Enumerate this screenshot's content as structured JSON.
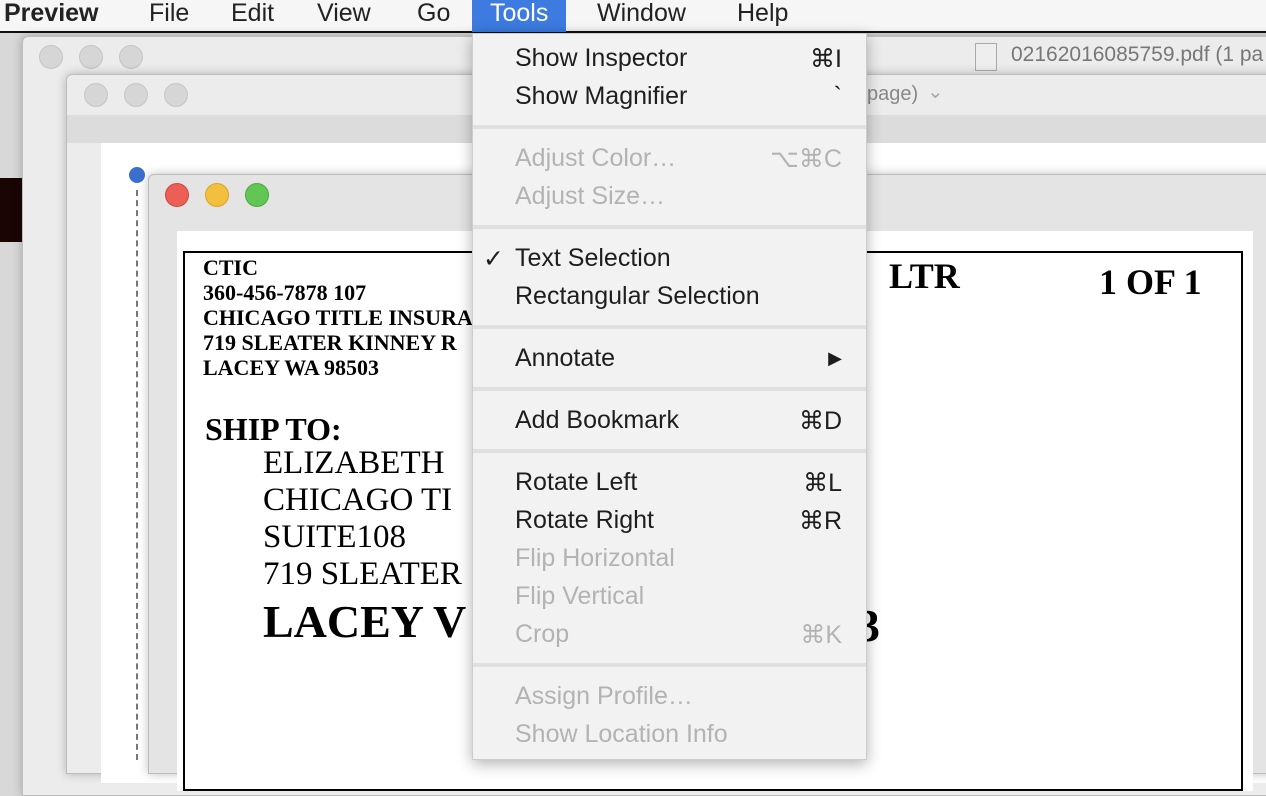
{
  "menubar": {
    "app": "Preview",
    "items": [
      "File",
      "Edit",
      "View",
      "Go",
      "Tools",
      "Window",
      "Help"
    ]
  },
  "windows": {
    "back_title": "02162016085759.pdf (1 pa",
    "middle_title_fragment": "page)"
  },
  "document": {
    "lines": [
      "CTIC",
      "360-456-7878 107",
      "CHICAGO TITLE INSURA",
      "719 SLEATER KINNEY R",
      "LACEY  WA 98503"
    ],
    "ship_to": "SHIP TO:",
    "ship_lines": [
      "ELIZABETH",
      "CHICAGO TI",
      "SUITE108",
      "719 SLEATER"
    ],
    "city": "LACEY   V",
    "zip_fragment": "3",
    "ltr": "LTR",
    "page_of": "1 OF 1"
  },
  "tools_menu": {
    "items": [
      {
        "label": "Show Inspector",
        "shortcut": "⌘I",
        "enabled": true
      },
      {
        "label": "Show Magnifier",
        "shortcut": "`",
        "enabled": true
      },
      {
        "sep": true
      },
      {
        "label": "Adjust Color…",
        "shortcut": "⌥⌘C",
        "enabled": false
      },
      {
        "label": "Adjust Size…",
        "shortcut": "",
        "enabled": false
      },
      {
        "sep": true
      },
      {
        "label": "Text Selection",
        "shortcut": "",
        "enabled": true,
        "checked": true
      },
      {
        "label": "Rectangular Selection",
        "shortcut": "",
        "enabled": true
      },
      {
        "sep": true
      },
      {
        "label": "Annotate",
        "shortcut": "▶",
        "enabled": true
      },
      {
        "sep": true
      },
      {
        "label": "Add Bookmark",
        "shortcut": "⌘D",
        "enabled": true
      },
      {
        "sep": true
      },
      {
        "label": "Rotate Left",
        "shortcut": "⌘L",
        "enabled": true
      },
      {
        "label": "Rotate Right",
        "shortcut": "⌘R",
        "enabled": true
      },
      {
        "label": "Flip Horizontal",
        "shortcut": "",
        "enabled": false
      },
      {
        "label": "Flip Vertical",
        "shortcut": "",
        "enabled": false
      },
      {
        "label": "Crop",
        "shortcut": "⌘K",
        "enabled": false
      },
      {
        "sep": true
      },
      {
        "label": "Assign Profile…",
        "shortcut": "",
        "enabled": false
      },
      {
        "label": "Show Location Info",
        "shortcut": "",
        "enabled": false
      }
    ],
    "check_glyph": "✓"
  },
  "colors": {
    "highlight": "#3d7be0",
    "close": "#ec5f57",
    "minimize": "#f3bf3f",
    "zoom": "#62c654"
  }
}
